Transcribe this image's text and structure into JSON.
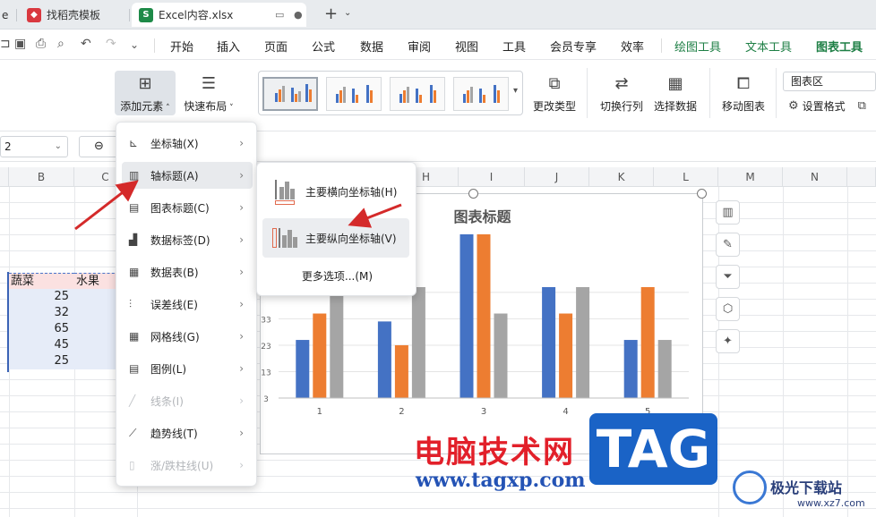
{
  "tabs": [
    {
      "label": "e",
      "active": false
    },
    {
      "label": "找稻壳模板",
      "active": false,
      "icon_color": "#d9383f"
    },
    {
      "label": "Excel内容.xlsx",
      "active": true,
      "icon_color": "#1e8a48",
      "icon_letter": "S"
    }
  ],
  "menu": {
    "items": [
      "开始",
      "插入",
      "页面",
      "公式",
      "数据",
      "审阅",
      "视图",
      "工具",
      "会员专享",
      "效率"
    ],
    "context_items": [
      "绘图工具",
      "文本工具",
      "图表工具"
    ],
    "active": "图表工具"
  },
  "ribbon": {
    "add_element": "添加元素",
    "quick_layout": "快速布局",
    "change_type": "更改类型",
    "switch_rowcol": "切换行列",
    "select_data": "选择数据",
    "move_chart": "移动图表",
    "chart_area": "图表区",
    "set_format": "设置格式"
  },
  "formula_bar": {
    "name_box": "2"
  },
  "columns": [
    "B",
    "C",
    "H",
    "I",
    "J",
    "K",
    "L",
    "M",
    "N"
  ],
  "sheet": {
    "headers": [
      "蔬菜",
      "水果"
    ],
    "values": [
      "25",
      "32",
      "65",
      "45",
      "25"
    ]
  },
  "chart": {
    "title": "图表标题",
    "y_ticks": [
      "3",
      "13",
      "23",
      "33",
      "43"
    ]
  },
  "chart_data": {
    "type": "bar",
    "title": "图表标题",
    "categories": [
      "1",
      "2",
      "3",
      "4",
      "5"
    ],
    "series": [
      {
        "values": [
          25,
          32,
          65,
          45,
          25
        ],
        "color": "#4472c4"
      },
      {
        "values": [
          35,
          23,
          65,
          35,
          45
        ],
        "color": "#ed7d31"
      },
      {
        "values": [
          55,
          45,
          35,
          45,
          25
        ],
        "color": "#a5a5a5"
      }
    ],
    "ylim": [
      3,
      66
    ],
    "grid": true
  },
  "dropdown": [
    {
      "label": "坐标轴(X)",
      "icon": "axis-icon",
      "glyph": "⊾",
      "disabled": false
    },
    {
      "label": "轴标题(A)",
      "icon": "axis-title-icon",
      "glyph": "▥",
      "disabled": false,
      "highlighted": true
    },
    {
      "label": "图表标题(C)",
      "icon": "chart-title-icon",
      "glyph": "▤",
      "disabled": false
    },
    {
      "label": "数据标签(D)",
      "icon": "data-label-icon",
      "glyph": "▟",
      "disabled": false
    },
    {
      "label": "数据表(B)",
      "icon": "data-table-icon",
      "glyph": "▦",
      "disabled": false
    },
    {
      "label": "误差线(E)",
      "icon": "error-bar-icon",
      "glyph": "⫶",
      "disabled": false
    },
    {
      "label": "网格线(G)",
      "icon": "gridline-icon",
      "glyph": "▦",
      "disabled": false
    },
    {
      "label": "图例(L)",
      "icon": "legend-icon",
      "glyph": "▤",
      "disabled": false
    },
    {
      "label": "线条(I)",
      "icon": "line-icon",
      "glyph": "╱",
      "disabled": true
    },
    {
      "label": "趋势线(T)",
      "icon": "trendline-icon",
      "glyph": "⟋",
      "disabled": false
    },
    {
      "label": "涨/跌柱线(U)",
      "icon": "updown-bar-icon",
      "glyph": "▯",
      "disabled": true
    }
  ],
  "submenu": {
    "items": [
      "主要横向坐标轴(H)",
      "主要纵向坐标轴(V)"
    ],
    "more": "更多选项...(M)"
  },
  "watermark": {
    "main": "电脑技术网",
    "url": "www.tagxp.com",
    "tag": "TAG",
    "site": "极光下载站",
    "site_url": "www.xz7.com"
  },
  "colors": {
    "accent_green": "#1e7f45",
    "arrow_red": "#d42a2a"
  }
}
